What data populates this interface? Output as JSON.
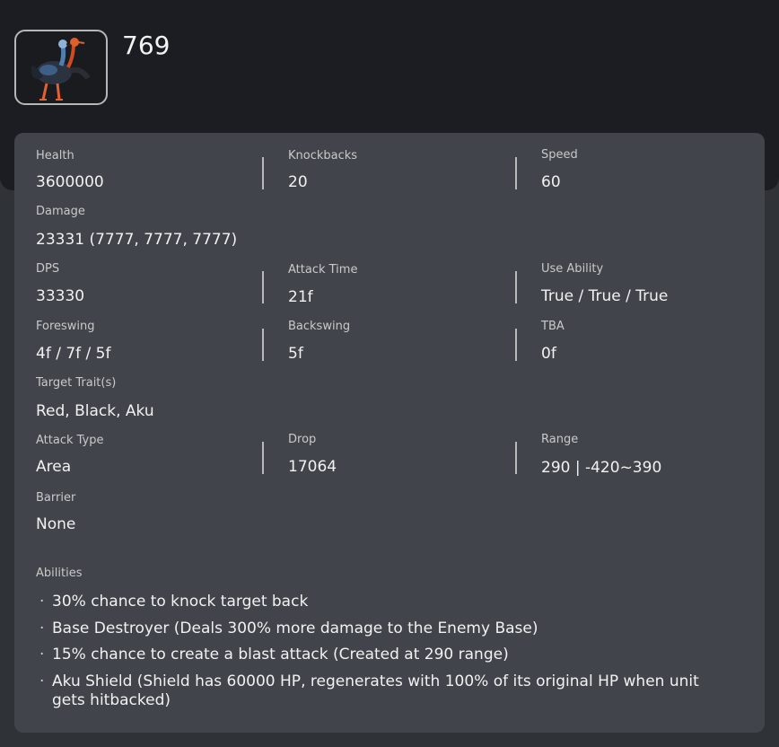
{
  "header": {
    "title": "769",
    "icon": "ostrich-enemy-icon"
  },
  "stats": {
    "health": {
      "label": "Health",
      "value": "3600000"
    },
    "knockbacks": {
      "label": "Knockbacks",
      "value": "20"
    },
    "speed": {
      "label": "Speed",
      "value": "60"
    },
    "damage": {
      "label": "Damage",
      "value": "23331 (7777, 7777, 7777)"
    },
    "dps": {
      "label": "DPS",
      "value": "33330"
    },
    "attack_time": {
      "label": "Attack Time",
      "value": "21f"
    },
    "use_ability": {
      "label": "Use Ability",
      "value": "True / True / True"
    },
    "foreswing": {
      "label": "Foreswing",
      "value": "4f / 7f / 5f"
    },
    "backswing": {
      "label": "Backswing",
      "value": "5f"
    },
    "tba": {
      "label": "TBA",
      "value": "0f"
    },
    "target_traits": {
      "label": "Target Trait(s)",
      "value": "Red, Black, Aku"
    },
    "attack_type": {
      "label": "Attack Type",
      "value": "Area"
    },
    "drop": {
      "label": "Drop",
      "value": "17064"
    },
    "range": {
      "label": "Range",
      "value": "290 | -420~390"
    },
    "barrier": {
      "label": "Barrier",
      "value": "None"
    }
  },
  "abilities": {
    "label": "Abilities",
    "items": [
      "30% chance to knock target back",
      "Base Destroyer (Deals 300% more damage to the Enemy Base)",
      "15% chance to create a blast attack (Created at 290 range)",
      "Aku Shield (Shield has 60000 HP, regenerates with 100% of its original HP when unit gets hitbacked)"
    ]
  }
}
